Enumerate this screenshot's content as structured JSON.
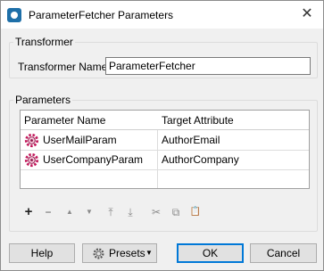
{
  "window": {
    "title": "ParameterFetcher Parameters"
  },
  "transformer": {
    "legend": "Transformer",
    "name_label": "Transformer Name:",
    "name_value": "ParameterFetcher"
  },
  "parameters": {
    "legend": "Parameters",
    "columns": [
      "Parameter Name",
      "Target Attribute"
    ],
    "rows": [
      {
        "name": "UserMailParam",
        "target": "AuthorEmail",
        "icon": "gear-icon"
      },
      {
        "name": "UserCompanyParam",
        "target": "AuthorCompany",
        "icon": "gear-icon"
      }
    ]
  },
  "toolbar": {
    "add": "+",
    "remove": "−",
    "move_up": "▲",
    "move_down": "▼",
    "move_top": "⤒",
    "move_bottom": "⤓",
    "cut": "✂",
    "copy": "⧉",
    "paste": "📋"
  },
  "footer": {
    "help_label": "Help",
    "presets_label": "Presets",
    "ok_label": "OK",
    "cancel_label": "Cancel"
  },
  "colors": {
    "accent": "#0078d7",
    "gear_pink": "#c2185b"
  }
}
